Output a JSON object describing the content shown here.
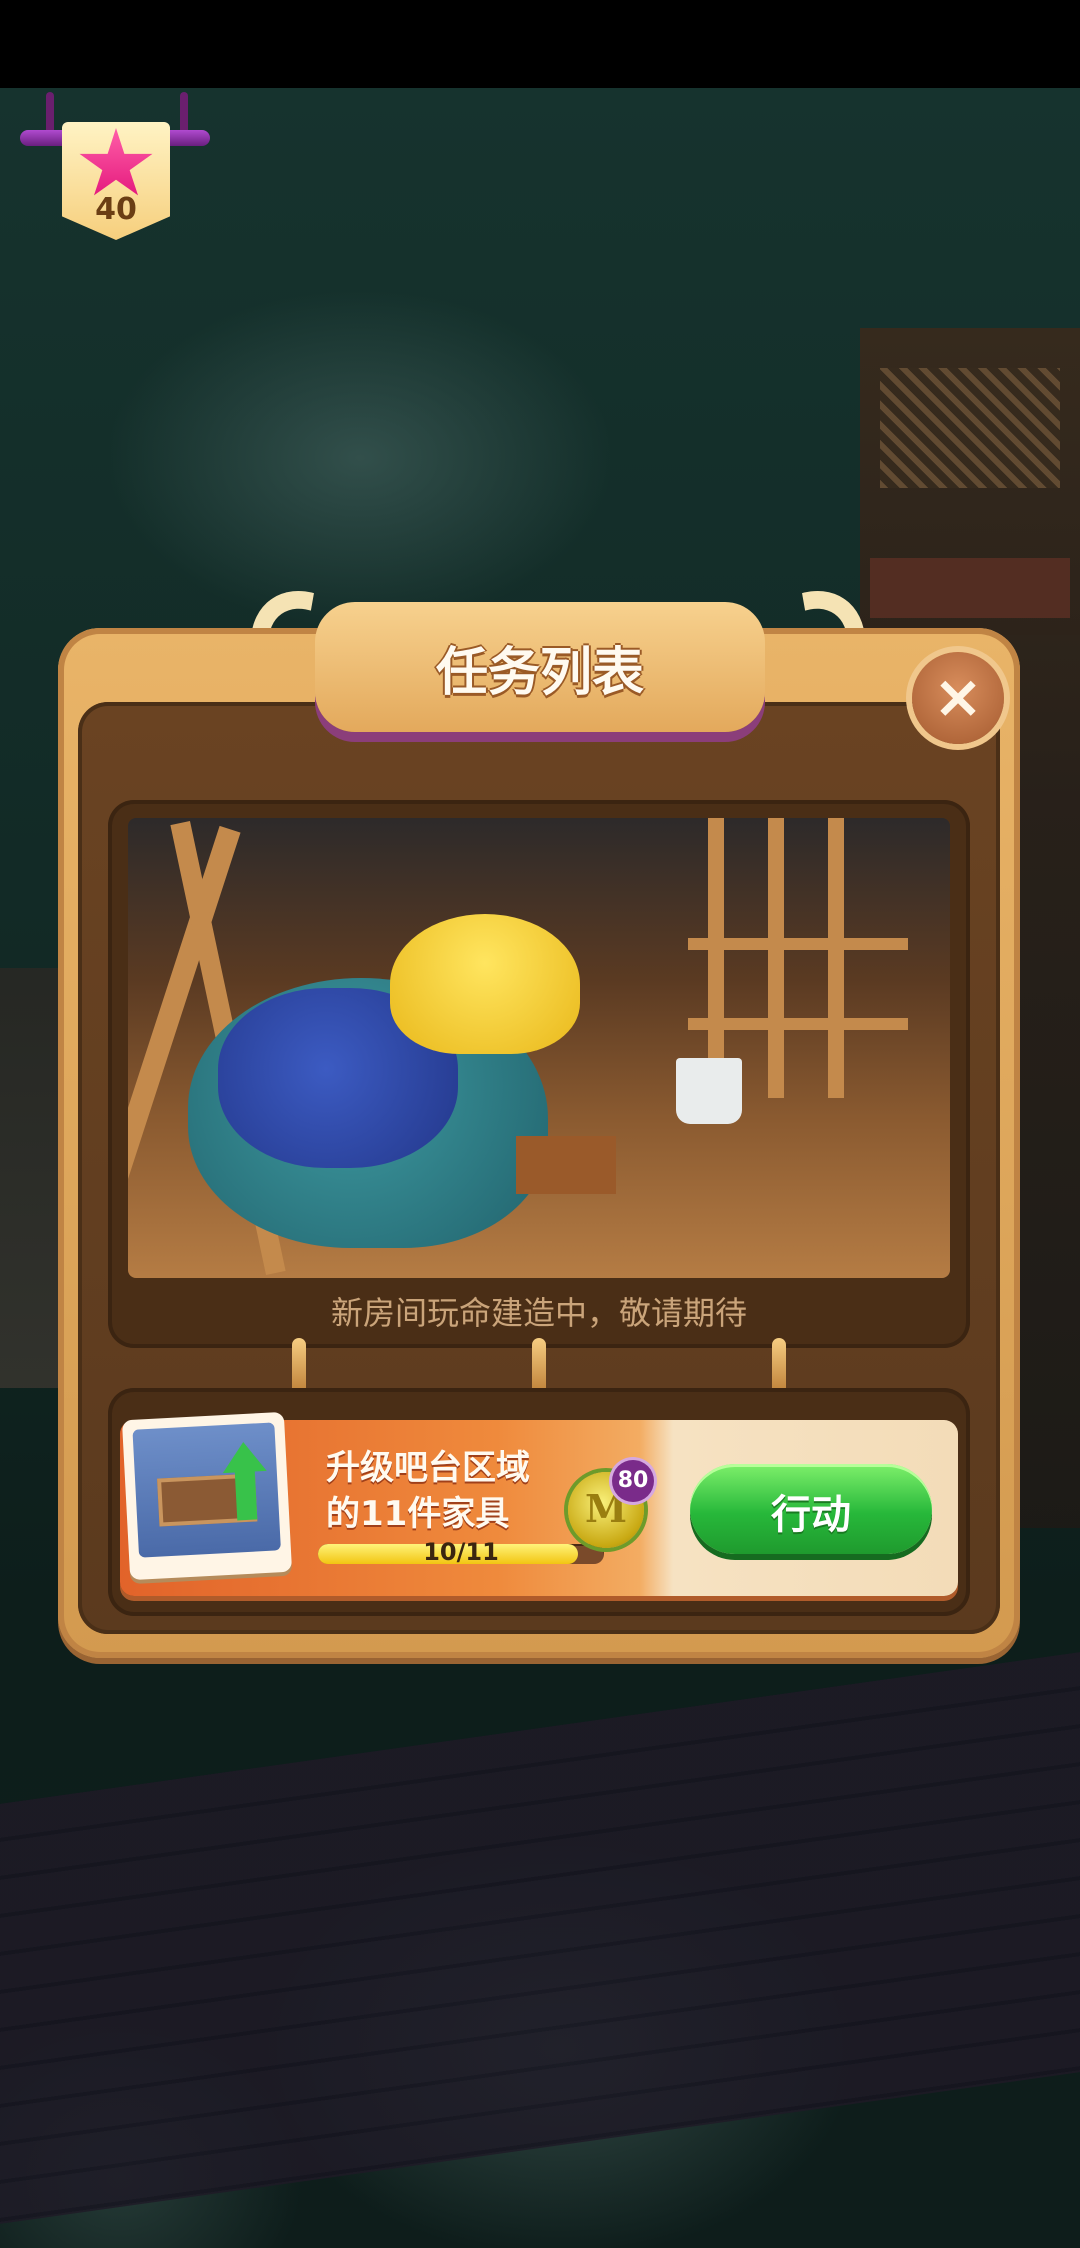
{
  "level_badge": {
    "level": "40",
    "icon": "star-icon",
    "color": "#e2147a"
  },
  "dialog": {
    "title": "任务列表",
    "close_icon": "close-icon",
    "caption": "新房间玩命建造中，敬请期待"
  },
  "task": {
    "title_line1": "升级吧台区域",
    "title_line2": "的11件家具",
    "progress_text": "10/11",
    "progress_fraction": 0.909,
    "reward_icon": "coin-icon",
    "reward_letter": "M",
    "reward_amount": "80",
    "action_label": "行动",
    "action_color": "#27b83a"
  }
}
